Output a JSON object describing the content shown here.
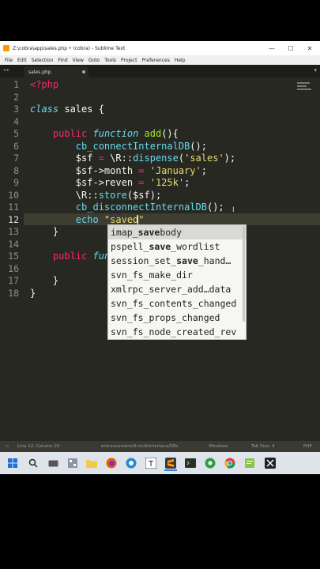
{
  "window": {
    "title": "Z:\\cobra\\app\\sales.php • (cobra) - Sublime Text",
    "minimize": "—",
    "maximize": "☐",
    "close": "✕"
  },
  "menu": [
    "File",
    "Edit",
    "Selection",
    "Find",
    "View",
    "Goto",
    "Tools",
    "Project",
    "Preferences",
    "Help"
  ],
  "tab": {
    "label": "sales.php",
    "nav": "◂ ▸",
    "menu": "▾"
  },
  "line_numbers": [
    "1",
    "2",
    "3",
    "4",
    "5",
    "6",
    "7",
    "8",
    "9",
    "10",
    "11",
    "12",
    "13",
    "14",
    "15",
    "16",
    "17",
    "18"
  ],
  "code": {
    "l1": "<?php",
    "l3_kw": "class",
    "l3_name": " sales {",
    "l5_indent": "    ",
    "l5_public": "public",
    "l5_function": " function",
    "l5_name": " add",
    "l5_rest": "(){",
    "l6_fn": "        cb_connectInternalDB",
    "l6_rest": "();",
    "l7_var": "        $sf",
    "l7_eq": " =",
    "l7_cls": " \\R::",
    "l7_fn": "dispense",
    "l7_open": "(",
    "l7_str": "'sales'",
    "l7_close": ");",
    "l8_var": "        $sf->month",
    "l8_eq": " =",
    "l8_str": " 'January'",
    "l8_end": ";",
    "l9_var": "        $sf->reven",
    "l9_eq": " =",
    "l9_str": " '125k'",
    "l9_end": ";",
    "l10_cls": "        \\R::",
    "l10_fn": "store",
    "l10_rest": "($sf);",
    "l11_fn": "        cb_disconnectInternalDB",
    "l11_rest": "();",
    "l12_echo": "        echo",
    "l12_str": " \"saved\"",
    "l13": "    }",
    "l15_indent": "    ",
    "l15_public": "public",
    "l15_function": " fun",
    "l17": "    }",
    "l18": "}"
  },
  "autocomplete": {
    "items": [
      "imap_savebody",
      "pspell_save_wordlist",
      "session_set_save_hand…",
      "svn_fs_make_dir",
      "xmlrpc_server_add…data",
      "svn_fs_contents_changed",
      "svn_fs_props_changed",
      "svn_fs_node_created_rev"
    ],
    "selected_index": 0
  },
  "status": {
    "position": "Line 12, Column 20",
    "branch": "entrancement/4-multiinterface/DBs",
    "line_endings": "Windows",
    "tab_size": "Tab Size: 4",
    "syntax": "PHP"
  },
  "taskbar": {
    "items": [
      "windows-start",
      "search",
      "task-view",
      "file-explorer",
      "folder",
      "firefox",
      "edge",
      "word",
      "typora",
      "sublime-text",
      "terminal",
      "app-green",
      "chrome",
      "notepad-plus",
      "app-x"
    ],
    "active": "sublime-text"
  },
  "colors": {
    "editor_bg": "#272822",
    "keyword": "#f92672",
    "storage": "#66d9ef",
    "function": "#a6e22e",
    "string": "#e6db74",
    "text": "#f8f8f2"
  }
}
